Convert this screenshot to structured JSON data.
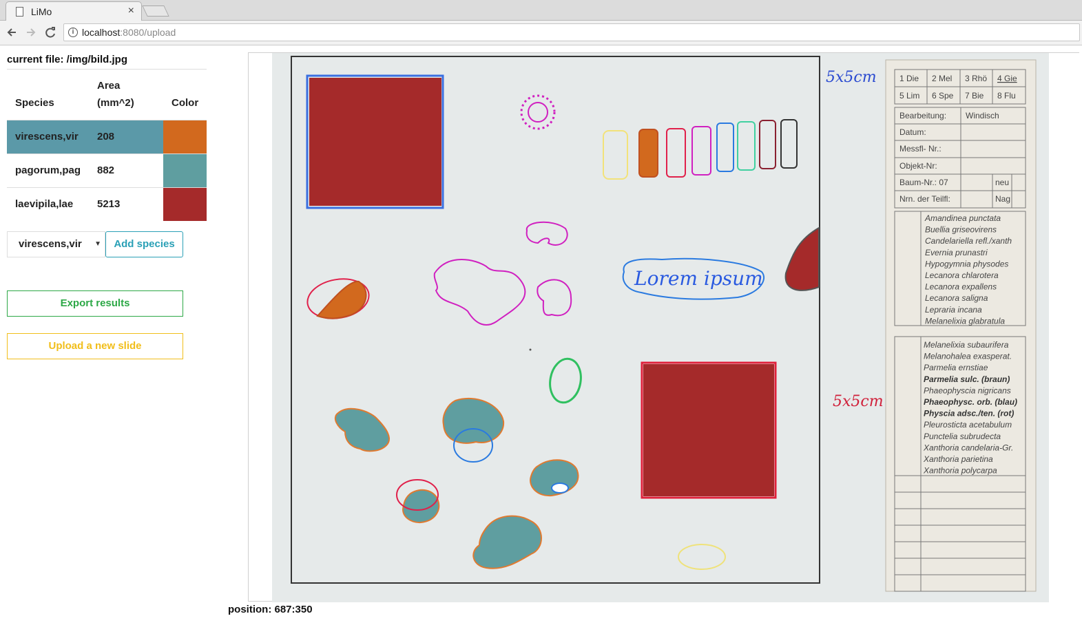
{
  "browser": {
    "tab_title": "LiMo",
    "tab_close": "×",
    "url_host": "localhost",
    "url_rest": ":8080/upload"
  },
  "sidebar": {
    "current_file_label": "current file: /img/bild.jpg",
    "table": {
      "headers": {
        "species": "Species",
        "area_line1": "Area",
        "area_line2": "(mm^2)",
        "color": "Color"
      },
      "rows": [
        {
          "species": "virescens,vir",
          "area": "208",
          "color": "#d2691e",
          "selected": true
        },
        {
          "species": "pagorum,pag",
          "area": "882",
          "color": "#5f9ea0",
          "selected": false
        },
        {
          "species": "laevipila,lae",
          "area": "5213",
          "color": "#a52a2a",
          "selected": false
        }
      ]
    },
    "species_select_value": "virescens,vir",
    "add_species_label": "Add species",
    "export_label": "Export results",
    "upload_label": "Upload a new slide"
  },
  "status": {
    "position_label": "position: 687:350"
  },
  "slide": {
    "handwriting_top": "5x5cm",
    "handwriting_mid": "5x5cm",
    "bubble_text": "Lorem ipsum",
    "form_codes": [
      "1 Die",
      "2 Mel",
      "3 Rhö",
      "4 Gie",
      "5 Lim",
      "6 Spe",
      "7 Bie",
      "8 Flu"
    ],
    "form_fields": [
      {
        "label": "Bearbeitung:",
        "value": "Windisch"
      },
      {
        "label": "Datum:",
        "value": ""
      },
      {
        "label": "Messfl- Nr.:",
        "value": ""
      },
      {
        "label": "Objekt-Nr:",
        "value": ""
      },
      {
        "label": "Baum-Nr.: 07",
        "value": "",
        "extra": "neu"
      },
      {
        "label": "Nrn. der Teilfl:",
        "value": "",
        "extra": "Nag"
      }
    ],
    "species_list_1": [
      "Amandinea punctata",
      "Buellia griseovirens",
      "Candelariella refl./xanth",
      "Evernia prunastri",
      "Hypogymnia physodes",
      "Lecanora chlarotera",
      "Lecanora expallens",
      "Lecanora saligna",
      "Lepraria incana",
      "Melanelixia glabratula"
    ],
    "species_list_2": [
      {
        "name": "Melanelixia subaurifera",
        "bold": false
      },
      {
        "name": "Melanohalea exasperat.",
        "bold": false
      },
      {
        "name": "Parmelia ernstiae",
        "bold": false
      },
      {
        "name": "Parmelia sulc. (braun)",
        "bold": true
      },
      {
        "name": "Phaeophyscia nigricans",
        "bold": false
      },
      {
        "name": "Phaeophysc. orb. (blau)",
        "bold": true
      },
      {
        "name": "Physcia adsc./ten. (rot)",
        "bold": true
      },
      {
        "name": "Pleurosticta acetabulum",
        "bold": false
      },
      {
        "name": "Punctelia subrudecta",
        "bold": false
      },
      {
        "name": "Xanthoria candelaria-Gr.",
        "bold": false
      },
      {
        "name": "Xanthoria parietina",
        "bold": false
      },
      {
        "name": "Xanthoria polycarpa",
        "bold": false
      }
    ]
  },
  "colors": {
    "vir": "#d2691e",
    "pag": "#5f9ea0",
    "lae": "#a52a2a",
    "accent": "#2aa0b6",
    "export": "#2ca846",
    "upload": "#f1be1a"
  }
}
